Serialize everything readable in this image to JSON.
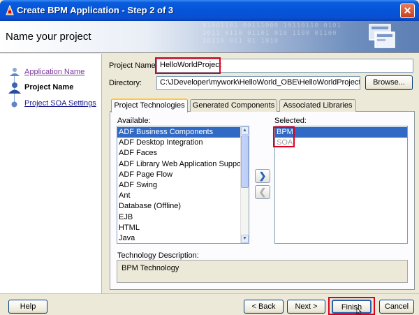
{
  "window": {
    "title": "Create BPM Application - Step 2 of 3",
    "close_glyph": "✕"
  },
  "header": {
    "page_title": "Name your project",
    "binary_text": "01001101 00111000 10110110 0101\n1011 0110 01101 010 1100 01100\n10110 011 01 1010"
  },
  "nav": {
    "items": [
      {
        "label": "Application Name",
        "state": "visited"
      },
      {
        "label": "Project Name",
        "state": "current"
      },
      {
        "label": "Project SOA Settings",
        "state": "link"
      }
    ]
  },
  "form": {
    "project_name_label": "Project Name:",
    "project_name_value": "HelloWorldProject",
    "directory_label": "Directory:",
    "directory_value": "C:\\JDeveloper\\mywork\\HelloWorld_OBE\\HelloWorldProject",
    "browse_label": "Browse..."
  },
  "tabs": [
    "Project Technologies",
    "Generated Components",
    "Associated Libraries"
  ],
  "available": {
    "label": "Available:",
    "items": [
      "ADF Business Components",
      "ADF Desktop Integration",
      "ADF Faces",
      "ADF Library Web Application Support",
      "ADF Page Flow",
      "ADF Swing",
      "Ant",
      "Database (Offline)",
      "EJB",
      "HTML",
      "Java"
    ],
    "selected_index": 0
  },
  "selected": {
    "label": "Selected:",
    "items": [
      "BPM",
      "SOA"
    ],
    "selected_index": 0
  },
  "transfer": {
    "add_glyph": "❯",
    "remove_glyph": "❮"
  },
  "description": {
    "label": "Technology Description:",
    "text": "BPM Technology"
  },
  "footer": {
    "help": "Help",
    "back": "< Back",
    "next": "Next >",
    "finish": "Finish",
    "cancel": "Cancel"
  },
  "colors": {
    "highlight": "#e0001b",
    "selection": "#316ac5",
    "titlebar": "#0554d9"
  },
  "icons": [
    "app-icon",
    "close-icon",
    "wizard-icon",
    "scroll-up-icon",
    "scroll-down-icon",
    "add-arrow-icon",
    "remove-arrow-icon",
    "mouse-cursor-icon"
  ]
}
